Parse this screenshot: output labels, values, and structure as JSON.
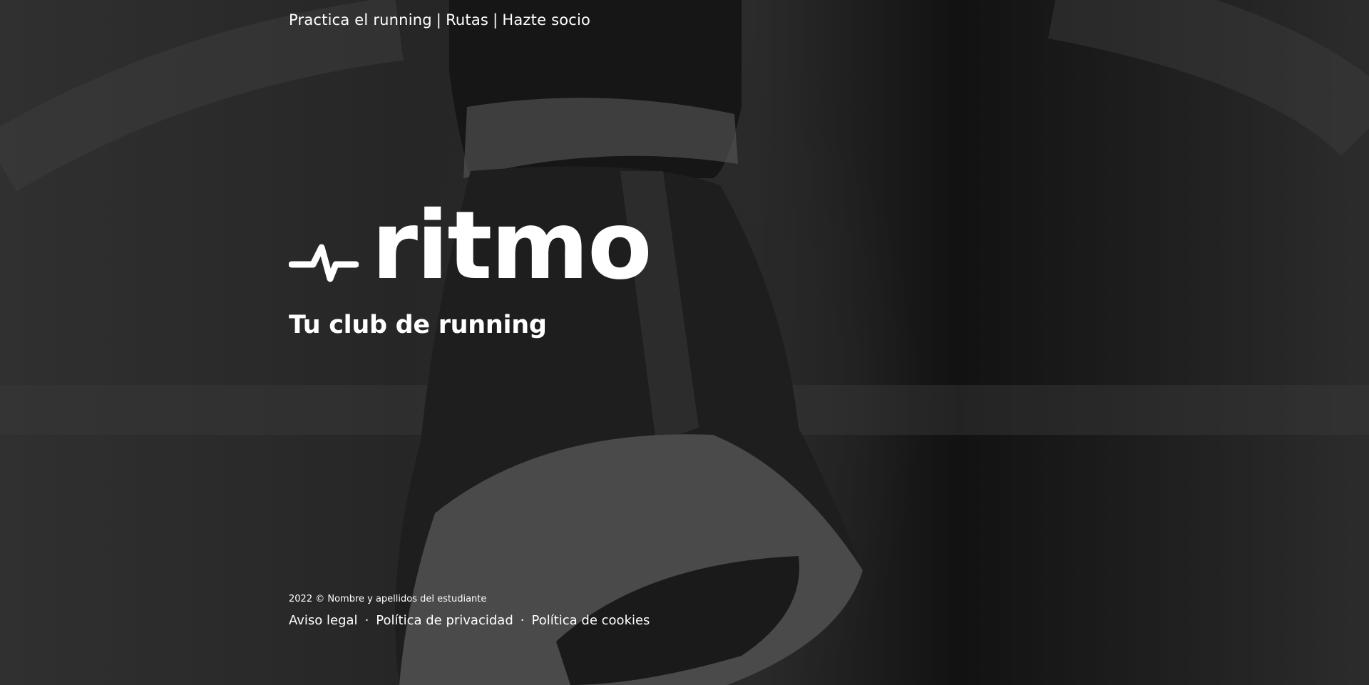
{
  "nav": {
    "items": [
      {
        "label": "Practica el running"
      },
      {
        "label": "Rutas"
      },
      {
        "label": "Hazte socio"
      }
    ],
    "separator": "|"
  },
  "brand": {
    "icon": "pulse-icon",
    "name": "ritmo",
    "tagline": "Tu club de running"
  },
  "footer": {
    "copyright": "2022 © Nombre y apellidos del estudiante",
    "links": [
      {
        "label": "Aviso legal"
      },
      {
        "label": "Política de privacidad"
      },
      {
        "label": "Política de cookies"
      }
    ],
    "separator": "·"
  },
  "colors": {
    "text": "#ffffff",
    "background": "#1c1c1c"
  }
}
